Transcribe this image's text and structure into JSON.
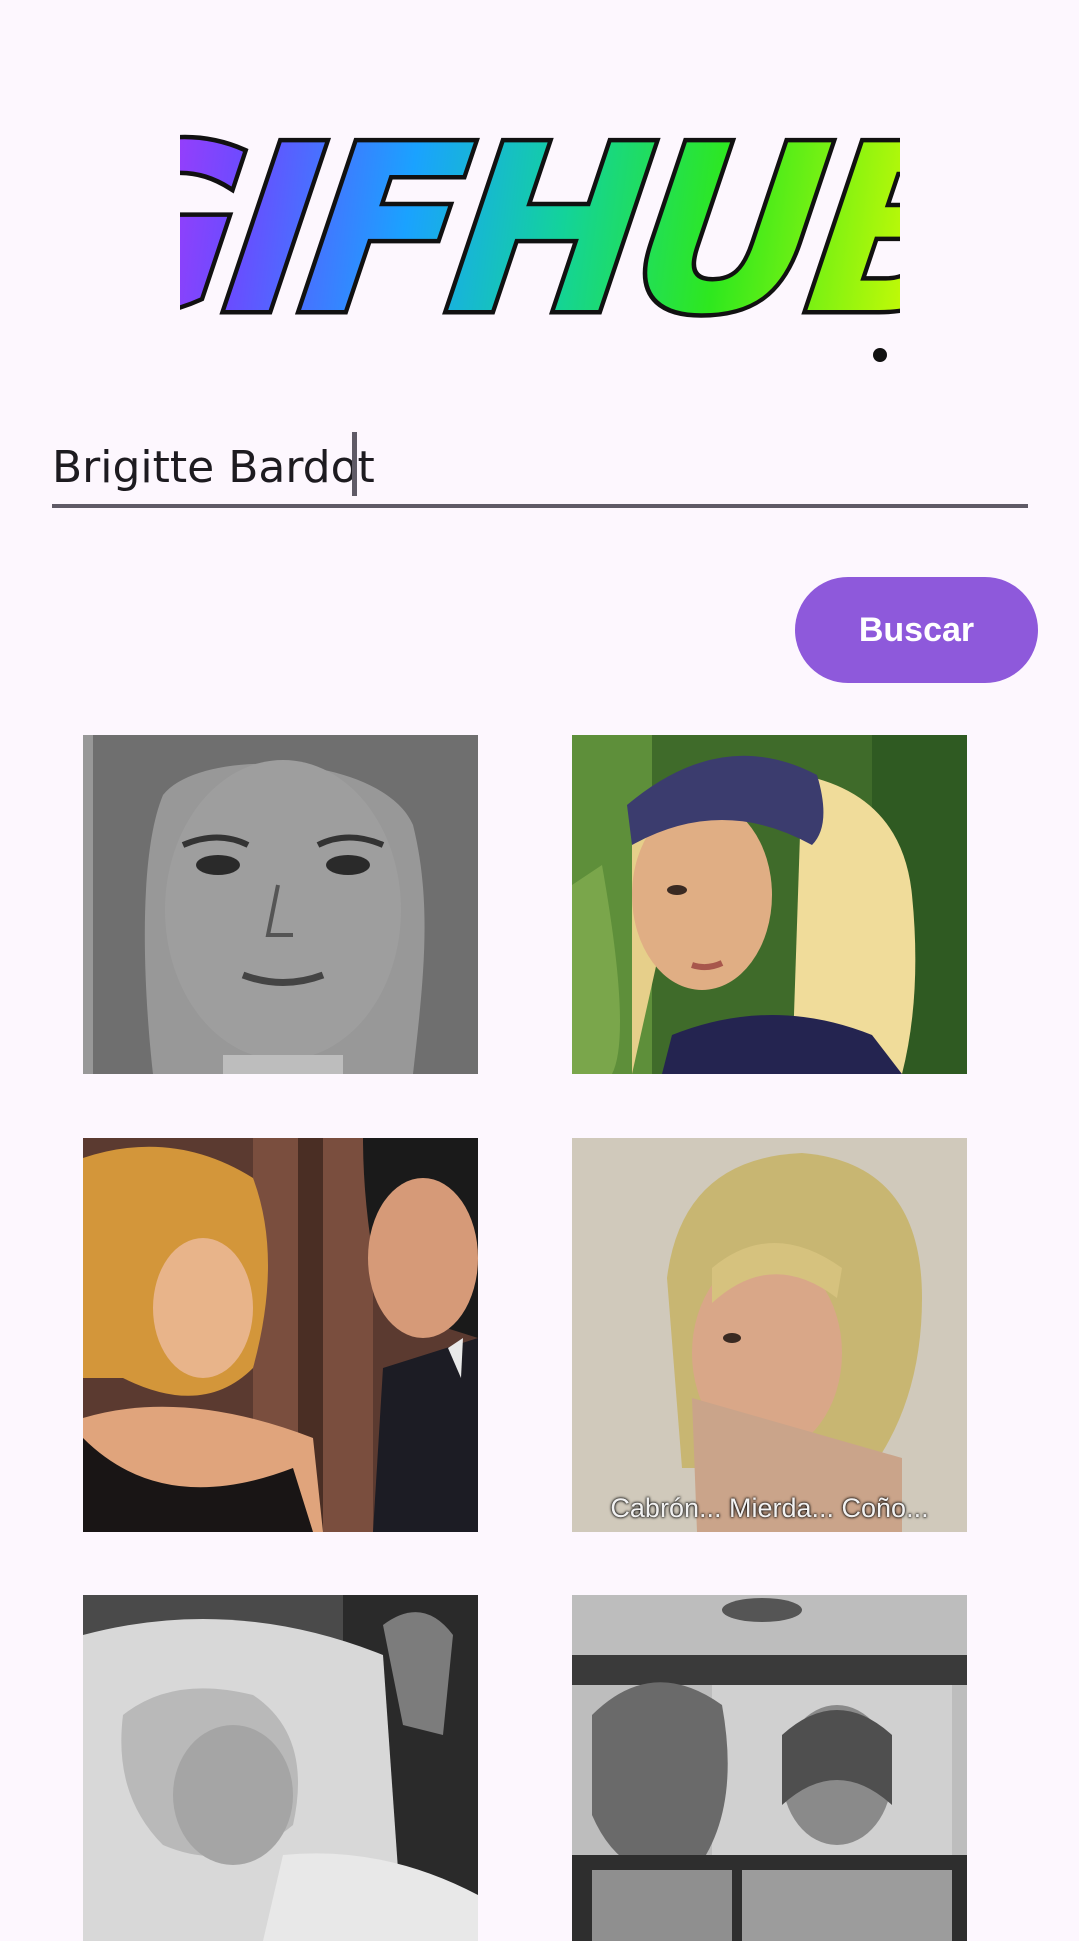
{
  "app": {
    "logo_text": "GIFHUB"
  },
  "search": {
    "value": "Brigitte Bardot",
    "button_label": "Buscar"
  },
  "results": [
    {
      "caption": ""
    },
    {
      "caption": ""
    },
    {
      "caption": ""
    },
    {
      "caption": "Cabrón... Mierda... Coño..."
    },
    {
      "caption": ""
    },
    {
      "caption": ""
    }
  ],
  "colors": {
    "background": "#fdf7fe",
    "accent": "#8e59db",
    "underline": "#5f5a66"
  }
}
